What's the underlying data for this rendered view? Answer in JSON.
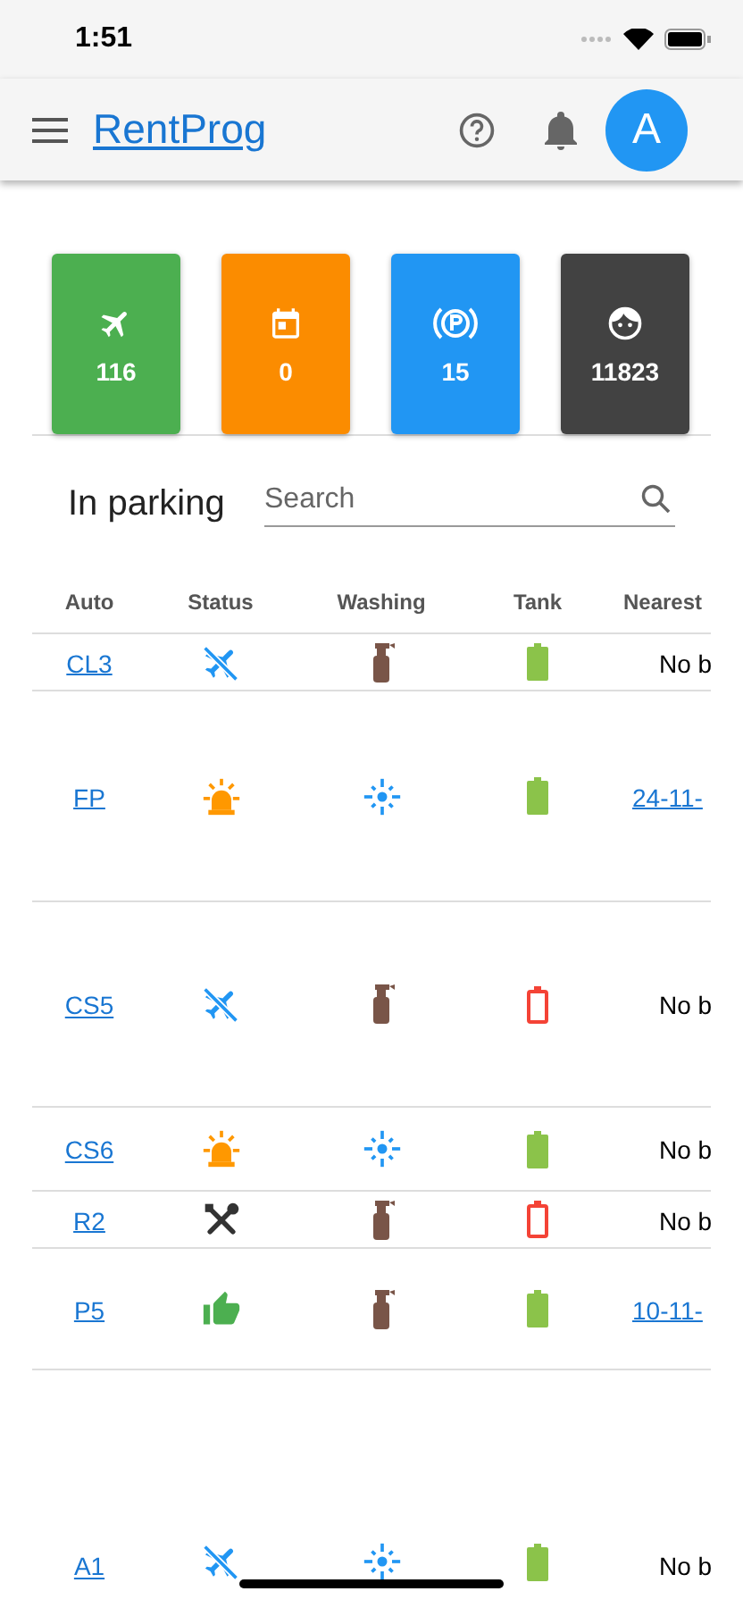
{
  "status_bar": {
    "time": "1:51"
  },
  "app_bar": {
    "title": "RentProg",
    "avatar": "A"
  },
  "stats": [
    {
      "kind": "flight",
      "value": "116",
      "color": "#4caf50"
    },
    {
      "kind": "calendar",
      "value": "0",
      "color": "#fb8c00"
    },
    {
      "kind": "parking",
      "value": "15",
      "color": "#2196f3"
    },
    {
      "kind": "face",
      "value": "11823",
      "color": "#424242"
    }
  ],
  "parking": {
    "title": "In parking",
    "search": {
      "placeholder": "Search"
    },
    "columns": [
      "Auto",
      "Status",
      "Washing",
      "Tank",
      "Nearest"
    ],
    "rows": [
      {
        "auto": "CL3",
        "status": {
          "kind": "flight-off"
        },
        "washing": {
          "kind": "dirty"
        },
        "tank": {
          "kind": "full"
        },
        "nearest": {
          "kind": "text",
          "text": "No b"
        }
      },
      {
        "auto": "FP",
        "status": {
          "kind": "alarm"
        },
        "washing": {
          "kind": "clean"
        },
        "tank": {
          "kind": "full"
        },
        "nearest": {
          "kind": "link",
          "text": "24-11-"
        }
      },
      {
        "auto": "CS5",
        "status": {
          "kind": "flight-off"
        },
        "washing": {
          "kind": "dirty"
        },
        "tank": {
          "kind": "empty"
        },
        "nearest": {
          "kind": "text",
          "text": "No b"
        }
      },
      {
        "auto": "CS6",
        "status": {
          "kind": "alarm"
        },
        "washing": {
          "kind": "clean"
        },
        "tank": {
          "kind": "full"
        },
        "nearest": {
          "kind": "text",
          "text": "No b"
        }
      },
      {
        "auto": "R2",
        "status": {
          "kind": "repair"
        },
        "washing": {
          "kind": "dirty"
        },
        "tank": {
          "kind": "empty"
        },
        "nearest": {
          "kind": "text",
          "text": "No b"
        }
      },
      {
        "auto": "P5",
        "status": {
          "kind": "ready"
        },
        "washing": {
          "kind": "dirty"
        },
        "tank": {
          "kind": "full"
        },
        "nearest": {
          "kind": "link",
          "text": "10-11-"
        }
      },
      {
        "auto": "A1",
        "status": {
          "kind": "flight-off"
        },
        "washing": {
          "kind": "clean"
        },
        "tank": {
          "kind": "full"
        },
        "nearest": {
          "kind": "text",
          "text": "No b"
        }
      }
    ]
  }
}
